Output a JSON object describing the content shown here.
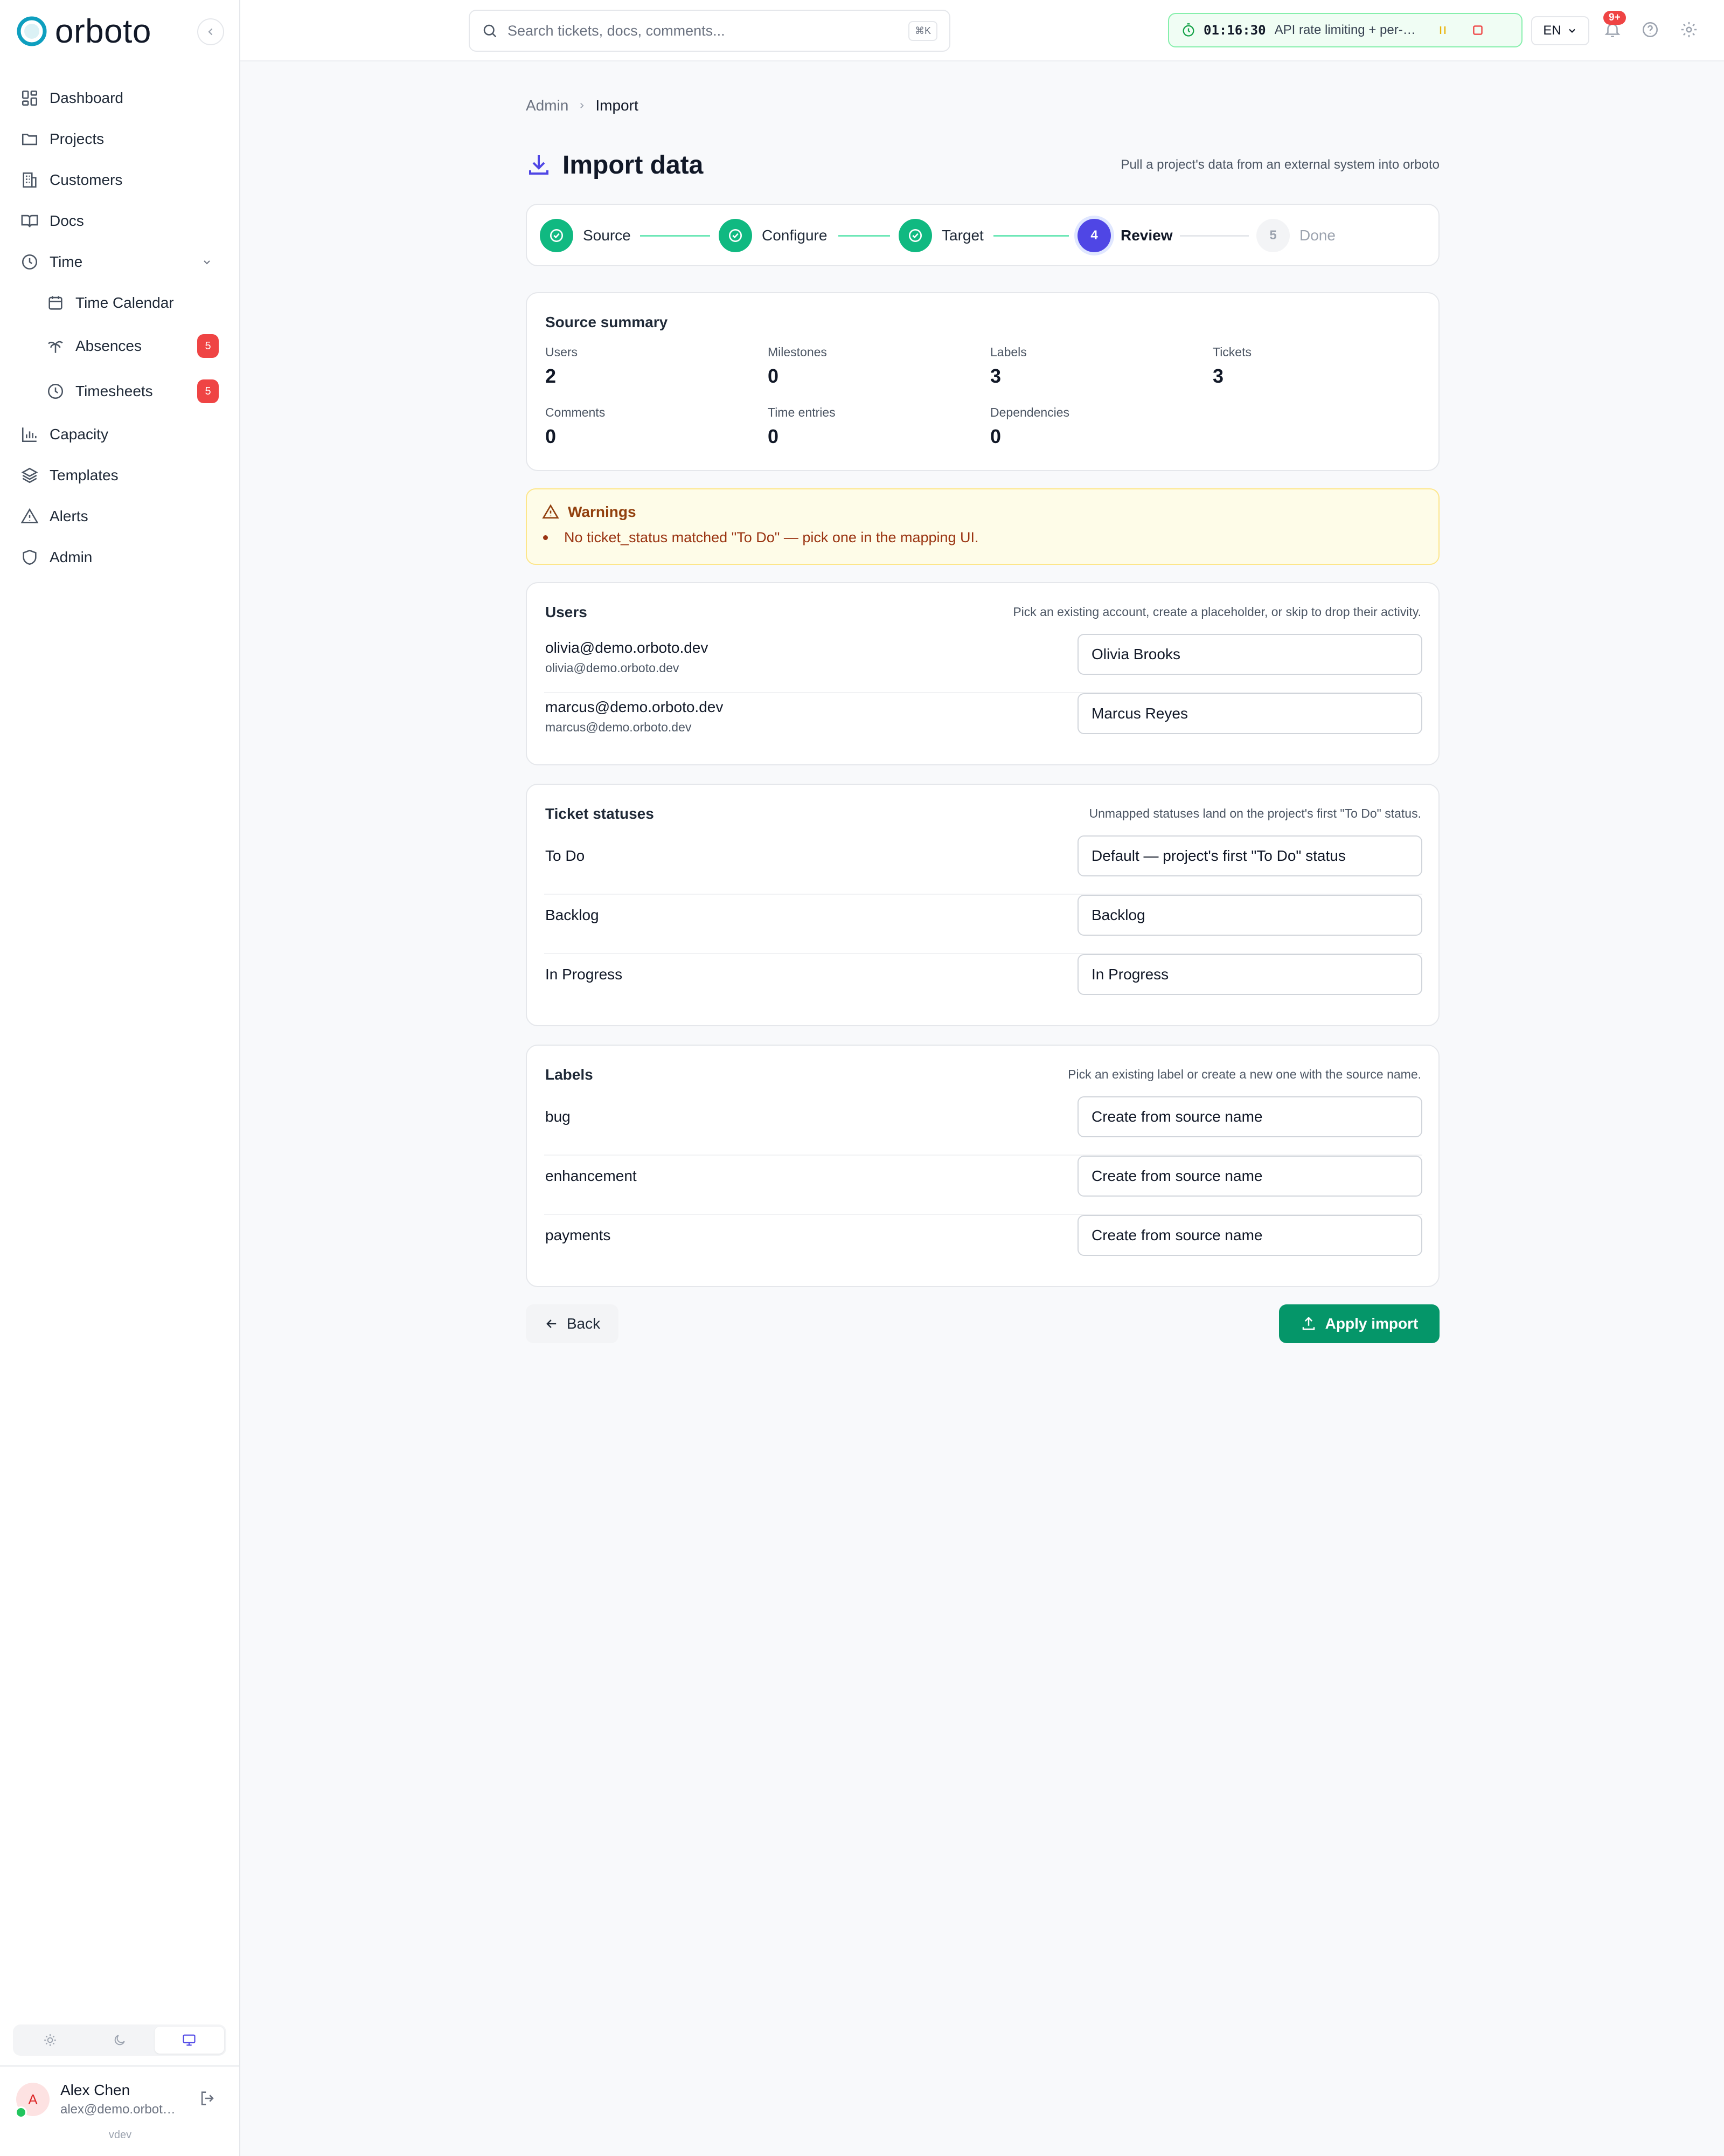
{
  "brand": {
    "name": "orboto",
    "accent": "#0e9fbf"
  },
  "sidebar": {
    "items": [
      {
        "label": "Dashboard",
        "icon": "dashboard-icon"
      },
      {
        "label": "Projects",
        "icon": "folder-icon"
      },
      {
        "label": "Customers",
        "icon": "building-icon"
      },
      {
        "label": "Docs",
        "icon": "book-icon"
      },
      {
        "label": "Time",
        "icon": "clock-icon"
      },
      {
        "label": "Time Calendar",
        "icon": "calendar-icon"
      },
      {
        "label": "Absences",
        "icon": "palm-tree-icon",
        "badge": "5"
      },
      {
        "label": "Timesheets",
        "icon": "clock-icon",
        "badge": "5"
      },
      {
        "label": "Capacity",
        "icon": "bar-chart-icon"
      },
      {
        "label": "Templates",
        "icon": "layers-icon"
      },
      {
        "label": "Alerts",
        "icon": "alert-icon"
      },
      {
        "label": "Admin",
        "icon": "shield-icon"
      }
    ],
    "user": {
      "initial": "A",
      "name": "Alex Chen",
      "email": "alex@demo.orboto.dev"
    },
    "version": "vdev"
  },
  "topbar": {
    "search_placeholder": "Search tickets, docs, comments...",
    "search_shortcut": "⌘K",
    "timer": {
      "elapsed": "01:16:30",
      "task": "API rate limiting + per-key quotas"
    },
    "language": "EN",
    "notifications_badge": "9+"
  },
  "breadcrumb": {
    "parent": "Admin",
    "current": "Import"
  },
  "page": {
    "title": "Import data",
    "subtitle": "Pull a project's data from an external system into orboto"
  },
  "stepper": {
    "steps": [
      {
        "number": "1",
        "label": "Source",
        "state": "done"
      },
      {
        "number": "2",
        "label": "Configure",
        "state": "done"
      },
      {
        "number": "3",
        "label": "Target",
        "state": "done"
      },
      {
        "number": "4",
        "label": "Review",
        "state": "current"
      },
      {
        "number": "5",
        "label": "Done",
        "state": "todo"
      }
    ]
  },
  "summary": {
    "title": "Source summary",
    "stats": [
      {
        "label": "Users",
        "value": "2"
      },
      {
        "label": "Milestones",
        "value": "0"
      },
      {
        "label": "Labels",
        "value": "3"
      },
      {
        "label": "Tickets",
        "value": "3"
      },
      {
        "label": "Comments",
        "value": "0"
      },
      {
        "label": "Time entries",
        "value": "0"
      },
      {
        "label": "Dependencies",
        "value": "0"
      }
    ]
  },
  "warnings": {
    "title": "Warnings",
    "items": [
      "No ticket_status matched \"To Do\" — pick one in the mapping UI."
    ]
  },
  "users_section": {
    "title": "Users",
    "hint": "Pick an existing account, create a placeholder, or skip to drop their activity.",
    "rows": [
      {
        "source": "olivia@demo.orboto.dev",
        "sub": "olivia@demo.orboto.dev",
        "target": "Olivia Brooks"
      },
      {
        "source": "marcus@demo.orboto.dev",
        "sub": "marcus@demo.orboto.dev",
        "target": "Marcus Reyes"
      }
    ]
  },
  "statuses_section": {
    "title": "Ticket statuses",
    "hint": "Unmapped statuses land on the project's first \"To Do\" status.",
    "rows": [
      {
        "source": "To Do",
        "target": "Default — project's first \"To Do\" status"
      },
      {
        "source": "Backlog",
        "target": "Backlog"
      },
      {
        "source": "In Progress",
        "target": "In Progress"
      }
    ]
  },
  "labels_section": {
    "title": "Labels",
    "hint": "Pick an existing label or create a new one with the source name.",
    "rows": [
      {
        "source": "bug",
        "target": "Create from source name"
      },
      {
        "source": "enhancement",
        "target": "Create from source name"
      },
      {
        "source": "payments",
        "target": "Create from source name"
      }
    ]
  },
  "actions": {
    "back": "Back",
    "apply": "Apply import"
  }
}
